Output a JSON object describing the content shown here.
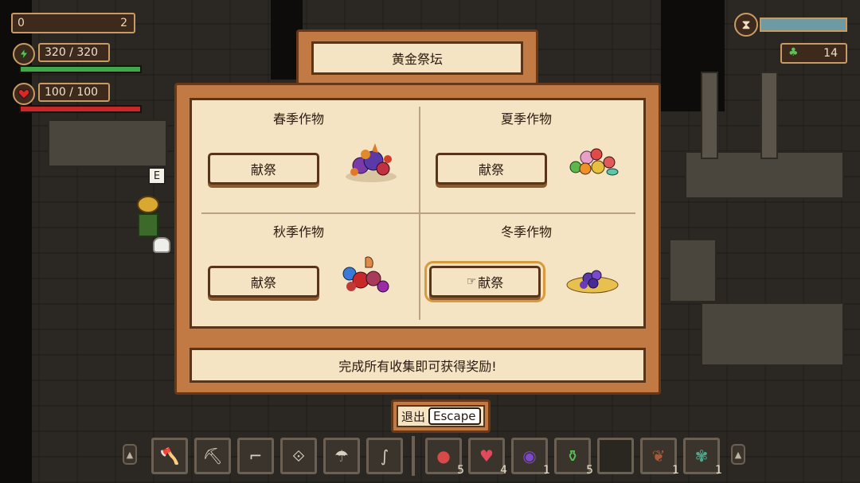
{
  "hud": {
    "gold_left": "0",
    "gold_right": "2",
    "energy": "320 / 320",
    "energy_fraction": 1.0,
    "health": "100 / 100",
    "health_fraction": 1.0,
    "clover_count": "14",
    "time_icon": "hourglass-icon",
    "prompt_key": "E"
  },
  "altar": {
    "title": "黄金祭坛",
    "offer_label": "献祭",
    "cells": [
      {
        "title": "春季作物"
      },
      {
        "title": "夏季作物"
      },
      {
        "title": "秋季作物"
      },
      {
        "title": "冬季作物"
      }
    ],
    "message": "完成所有收集即可获得奖励!"
  },
  "exit": {
    "label": "退出",
    "key": "Escape"
  },
  "toolbar": {
    "slots": [
      {
        "icon": "axe-icon",
        "count": ""
      },
      {
        "icon": "pickaxe-icon",
        "count": ""
      },
      {
        "icon": "hoe-icon",
        "count": ""
      },
      {
        "icon": "scythe-icon",
        "count": ""
      },
      {
        "icon": "watering-can-icon",
        "count": ""
      },
      {
        "icon": "fishing-rod-icon",
        "count": ""
      },
      {
        "icon": "red-seed-bag-icon",
        "count": "5"
      },
      {
        "icon": "strawberry-seed-icon",
        "count": "4"
      },
      {
        "icon": "purple-seed-icon",
        "count": "1"
      },
      {
        "icon": "green-potion-icon",
        "count": "5"
      },
      {
        "icon": "empty-slot",
        "count": ""
      },
      {
        "icon": "brown-leaf-icon",
        "count": "1"
      },
      {
        "icon": "green-bug-icon",
        "count": "1"
      }
    ]
  },
  "colors": {
    "frame": "#c27a45",
    "parchment": "#f4e4c4",
    "energy": "#3fa84a",
    "health": "#c8282a"
  }
}
